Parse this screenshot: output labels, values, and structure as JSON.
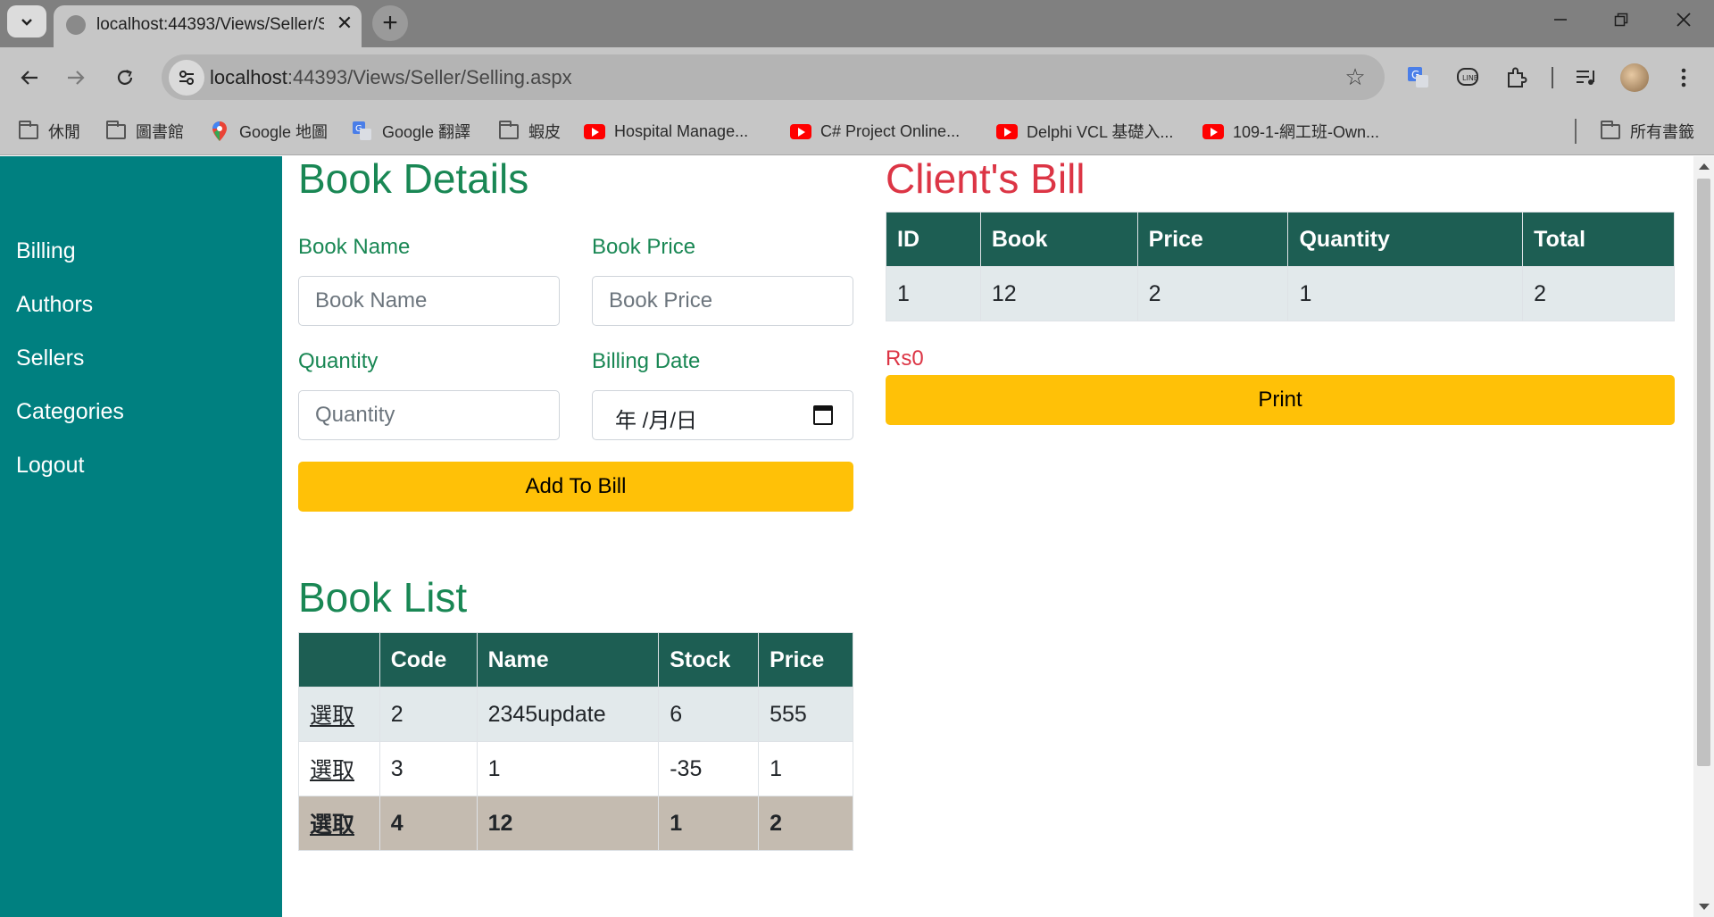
{
  "browser": {
    "tab_title": "localhost:44393/Views/Seller/Selling.aspx",
    "url_host": "localhost",
    "url_rest": ":44393/Views/Seller/Selling.aspx",
    "bookmarks": [
      {
        "label": "休閒",
        "icon": "folder-icon"
      },
      {
        "label": "圖書館",
        "icon": "folder-icon"
      },
      {
        "label": "Google 地圖",
        "icon": "google-maps-icon"
      },
      {
        "label": "Google 翻譯",
        "icon": "google-translate-icon"
      },
      {
        "label": "蝦皮",
        "icon": "folder-icon"
      },
      {
        "label": "Hospital Manage...",
        "icon": "youtube-icon"
      },
      {
        "label": "C# Project Online...",
        "icon": "youtube-icon"
      },
      {
        "label": "Delphi VCL 基礎入...",
        "icon": "youtube-icon"
      },
      {
        "label": "109-1-網工班-Own...",
        "icon": "youtube-icon"
      },
      {
        "label": "所有書籤",
        "icon": "folder-icon"
      }
    ]
  },
  "sidebar": {
    "items": [
      "Billing",
      "Authors",
      "Sellers",
      "Categories",
      "Logout"
    ]
  },
  "book_details": {
    "title": "Book Details",
    "book_name_label": "Book Name",
    "book_name_placeholder": "Book Name",
    "book_price_label": "Book Price",
    "book_price_placeholder": "Book Price",
    "quantity_label": "Quantity",
    "quantity_placeholder": "Quantity",
    "billing_date_label": "Billing Date",
    "billing_date_value": "年 /月/日",
    "add_button": "Add To Bill"
  },
  "book_list": {
    "title": "Book List",
    "columns": [
      "",
      "Code",
      "Name",
      "Stock",
      "Price"
    ],
    "select_label": "選取",
    "rows": [
      {
        "code": "2",
        "name": "2345update",
        "stock": "6",
        "price": "555"
      },
      {
        "code": "3",
        "name": "1",
        "stock": "-35",
        "price": "1"
      },
      {
        "code": "4",
        "name": "12",
        "stock": "1",
        "price": "2"
      }
    ]
  },
  "client_bill": {
    "title": "Client's Bill",
    "columns": [
      "ID",
      "Book",
      "Price",
      "Quantity",
      "Total"
    ],
    "rows": [
      {
        "id": "1",
        "book": "12",
        "price": "2",
        "quantity": "1",
        "total": "2"
      }
    ],
    "grand_total": "Rs0",
    "print_button": "Print"
  },
  "colors": {
    "sidebar": "#008080",
    "heading_green": "#198754",
    "heading_red": "#dc3545",
    "table_header": "#1d5e53",
    "button_yellow": "#ffc107",
    "selected_row": "#c4bbb0"
  }
}
